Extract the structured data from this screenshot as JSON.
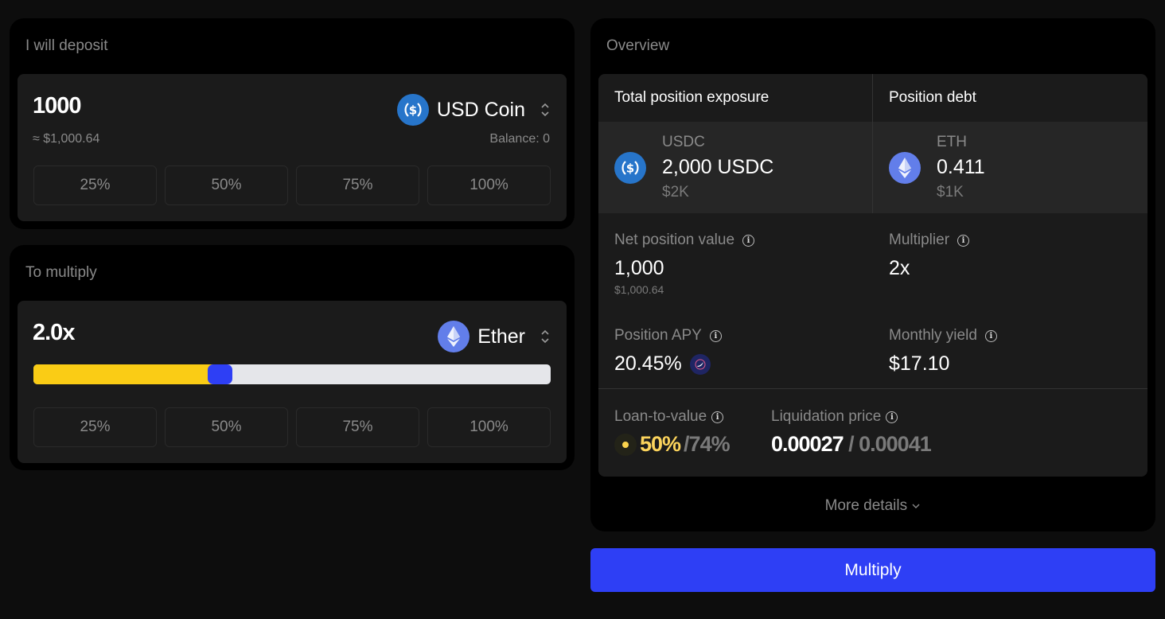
{
  "deposit": {
    "title": "I will deposit",
    "amount": "1000",
    "usd_estimate": "≈ $1,000.64",
    "token": {
      "name": "USD Coin",
      "icon": "usdc-icon",
      "color": "#2775ca"
    },
    "balance": "Balance: 0",
    "percent_buttons": [
      "25%",
      "50%",
      "75%",
      "100%"
    ]
  },
  "multiply": {
    "title": "To multiply",
    "multiplier": "2.0x",
    "token": {
      "name": "Ether",
      "icon": "eth-icon",
      "color": "#627eea"
    },
    "slider": {
      "value": 2.0,
      "fraction": 0.36,
      "fill_color": "#facc15",
      "handle_color": "#2e3ff5"
    },
    "percent_buttons": [
      "25%",
      "50%",
      "75%",
      "100%"
    ]
  },
  "overview": {
    "title": "Overview",
    "exposure": {
      "label": "Total position exposure",
      "symbol": "USDC",
      "amount": "2,000 USDC",
      "usd": "$2K"
    },
    "debt": {
      "label": "Position debt",
      "symbol": "ETH",
      "amount": "0.411",
      "usd": "$1K"
    },
    "net_position": {
      "label": "Net position value",
      "value": "1,000",
      "sub": "$1,000.64"
    },
    "multiplier": {
      "label": "Multiplier",
      "value": "2x"
    },
    "apy": {
      "label": "Position APY",
      "value": "20.45%"
    },
    "monthly_yield": {
      "label": "Monthly yield",
      "value": "$17.10"
    },
    "ltv": {
      "label": "Loan-to-value",
      "current": "50%",
      "max": "/74%",
      "status_color": "#fbd34d"
    },
    "liquidation": {
      "label": "Liquidation price",
      "current": "0.00027",
      "separator": " / ",
      "threshold": "0.00041"
    },
    "more_details": "More details"
  },
  "action": {
    "label": "Multiply",
    "color": "#2e3ff5"
  }
}
